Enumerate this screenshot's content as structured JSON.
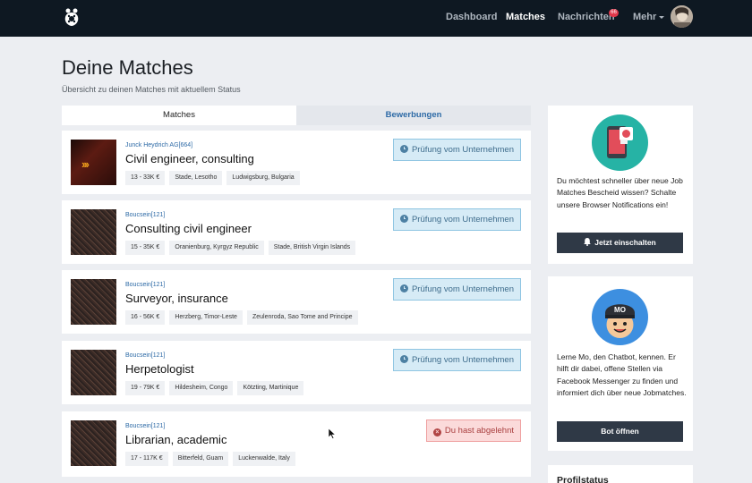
{
  "nav": {
    "items": [
      {
        "label": "Dashboard"
      },
      {
        "label": "Matches"
      },
      {
        "label": "Nachrichten",
        "badge": "66"
      },
      {
        "label": "Mehr"
      }
    ]
  },
  "header": {
    "title": "Deine Matches",
    "subtitle": "Übersicht zu deinen Matches mit aktuellem Status"
  },
  "tabs": [
    {
      "label": "Matches"
    },
    {
      "label": "Bewerbungen"
    }
  ],
  "matches": [
    {
      "company": "Junck Heydrich AG[664]",
      "title": "Civil engineer, consulting",
      "tags": [
        "13 - 33K €",
        "Stade, Lesotho",
        "Ludwigsburg, Bulgaria"
      ],
      "status": "Prüfung vom Unternehmen"
    },
    {
      "company": "Boucsein[121]",
      "title": "Consulting civil engineer",
      "tags": [
        "15 - 35K €",
        "Oranienburg, Kyrgyz Republic",
        "Stade, British Virgin Islands"
      ],
      "status": "Prüfung vom Unternehmen"
    },
    {
      "company": "Boucsein[121]",
      "title": "Surveyor, insurance",
      "tags": [
        "16 - 56K €",
        "Herzberg, Timor-Leste",
        "Zeulenroda, Sao Tome and Principe"
      ],
      "status": "Prüfung vom Unternehmen"
    },
    {
      "company": "Boucsein[121]",
      "title": "Herpetologist",
      "tags": [
        "19 - 79K €",
        "Hildesheim, Congo",
        "Kötzting, Martinique"
      ],
      "status": "Prüfung vom Unternehmen"
    },
    {
      "company": "Boucsein[121]",
      "title": "Librarian, academic",
      "tags": [
        "17 - 117K €",
        "Bitterfeld, Guam",
        "Luckenwalde, Italy"
      ],
      "status": "Du hast abgelehnt"
    }
  ],
  "sidebar": {
    "notifications": {
      "text": "Du möchtest schneller über neue Job Matches Bescheid wissen? Schalte unsere Browser Notifications ein!",
      "button": "Jetzt einschalten"
    },
    "chatbot": {
      "text": "Lerne Mo, den Chatbot, kennen. Er hilft dir dabei, offene Stellen via Facebook Messenger zu finden und informiert dich über neue Jobmatches.",
      "button": "Bot öffnen",
      "cap_text": "MO"
    },
    "profile": {
      "title": "Profilstatus"
    }
  },
  "colors": {
    "navbar": "#0e1822",
    "link": "#2d6aa6",
    "pending_bg": "#d6ebf6",
    "rejected_bg": "#fbdada",
    "button_dark": "#2f3946",
    "teal": "#26b3a5",
    "blue": "#3d8fe0"
  }
}
